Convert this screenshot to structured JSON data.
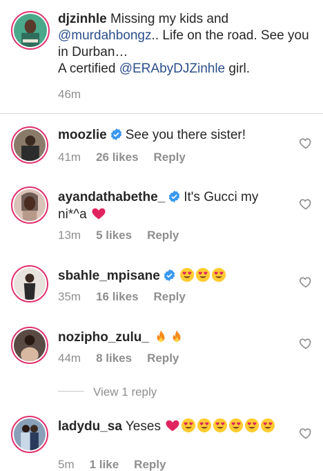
{
  "caption": {
    "username": "djzinhle",
    "text_1": "Missing my kids and",
    "mention_1": "@murdahbongz",
    "text_2": ".. Life on the road. See you in Durban…",
    "text_3": "A certified",
    "mention_2": "@ERAbyDJZinhle",
    "text_4": "girl.",
    "time": "46m"
  },
  "comments": [
    {
      "username": "moozlie",
      "verified": true,
      "text": "See you there sister!",
      "time": "41m",
      "likes": "26 likes",
      "reply": "Reply"
    },
    {
      "username": "ayandathabethe_",
      "verified": true,
      "text": "It's Gucci my ni*^a",
      "emojis": [
        "red-heart"
      ],
      "time": "13m",
      "likes": "5 likes",
      "reply": "Reply"
    },
    {
      "username": "sbahle_mpisane",
      "verified": true,
      "text": "",
      "emojis": [
        "heart-eyes",
        "heart-eyes",
        "heart-eyes"
      ],
      "time": "35m",
      "likes": "16 likes",
      "reply": "Reply"
    },
    {
      "username": "nozipho_zulu_",
      "verified": false,
      "text": "",
      "emojis": [
        "fire",
        "fire"
      ],
      "time": "44m",
      "likes": "8 likes",
      "reply": "Reply"
    },
    {
      "username": "ladydu_sa",
      "verified": false,
      "text": "Yeses",
      "emojis": [
        "red-heart",
        "heart-eyes",
        "heart-eyes",
        "heart-eyes",
        "heart-eyes",
        "heart-eyes",
        "heart-eyes"
      ],
      "time": "5m",
      "likes": "1 like",
      "reply": "Reply"
    }
  ],
  "view_replies": "View 1 reply",
  "colors": {
    "mention": "#2b4f8a",
    "verified": "#3897f0",
    "heart_emoji": "#e0245e",
    "meta": "#8e8e8e",
    "story_ring": "#e1306c"
  }
}
